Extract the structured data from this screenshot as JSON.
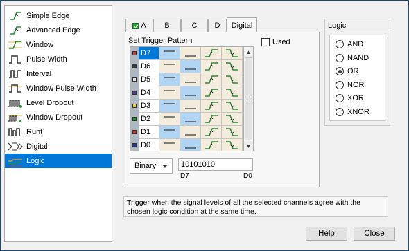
{
  "trigger_types": [
    {
      "label": "Simple Edge",
      "icon": "simple-edge-icon",
      "selected": false
    },
    {
      "label": "Advanced Edge",
      "icon": "advanced-edge-icon",
      "selected": false
    },
    {
      "label": "Window",
      "icon": "window-icon",
      "selected": false
    },
    {
      "label": "Pulse Width",
      "icon": "pulse-width-icon",
      "selected": false
    },
    {
      "label": "Interval",
      "icon": "interval-icon",
      "selected": false
    },
    {
      "label": "Window Pulse Width",
      "icon": "window-pulse-width-icon",
      "selected": false
    },
    {
      "label": "Level Dropout",
      "icon": "level-dropout-icon",
      "selected": false
    },
    {
      "label": "Window Dropout",
      "icon": "window-dropout-icon",
      "selected": false
    },
    {
      "label": "Runt",
      "icon": "runt-icon",
      "selected": false
    },
    {
      "label": "Digital",
      "icon": "digital-icon",
      "selected": false
    },
    {
      "label": "Logic",
      "icon": "logic-icon",
      "selected": true
    }
  ],
  "tabs": [
    {
      "label": "A",
      "checked": true,
      "active": false
    },
    {
      "label": "B",
      "checked": false,
      "active": false
    },
    {
      "label": "C",
      "checked": false,
      "active": false
    },
    {
      "label": "D",
      "checked": false,
      "active": false
    },
    {
      "label": "Digital",
      "checked": false,
      "active": true
    }
  ],
  "pattern": {
    "title": "Set Trigger Pattern",
    "used_label": "Used",
    "used_checked": false,
    "channels": [
      {
        "name": "D7",
        "color": "#c83b3b",
        "state": "high",
        "selected": true
      },
      {
        "name": "D6",
        "color": "#3b3b3b",
        "state": "low",
        "selected": false
      },
      {
        "name": "D5",
        "color": "#e0e0e0",
        "state": "high",
        "selected": false
      },
      {
        "name": "D4",
        "color": "#5a3a8a",
        "state": "low",
        "selected": false
      },
      {
        "name": "D3",
        "color": "#e8d23a",
        "state": "high",
        "selected": false
      },
      {
        "name": "D2",
        "color": "#2c8a3a",
        "state": "low",
        "selected": false
      },
      {
        "name": "D1",
        "color": "#c83b3b",
        "state": "high",
        "selected": false
      },
      {
        "name": "D0",
        "color": "#2a3a8a",
        "state": "low",
        "selected": false
      }
    ],
    "format_value": "Binary",
    "value": "10101010",
    "msb_label": "D7",
    "lsb_label": "D0"
  },
  "logic": {
    "title": "Logic",
    "options": [
      "AND",
      "NAND",
      "OR",
      "NOR",
      "XOR",
      "XNOR"
    ],
    "selected": "OR"
  },
  "description": "Trigger when the signal levels of all the selected channels agree with the chosen logic condition at the same time.",
  "buttons": {
    "help": "Help",
    "close": "Close"
  },
  "colors": {
    "accent": "#0078d7",
    "cell_on": "#b0d4f1",
    "cell_off": "#f3ecdc",
    "edge_icon": "#2c8a3a"
  }
}
